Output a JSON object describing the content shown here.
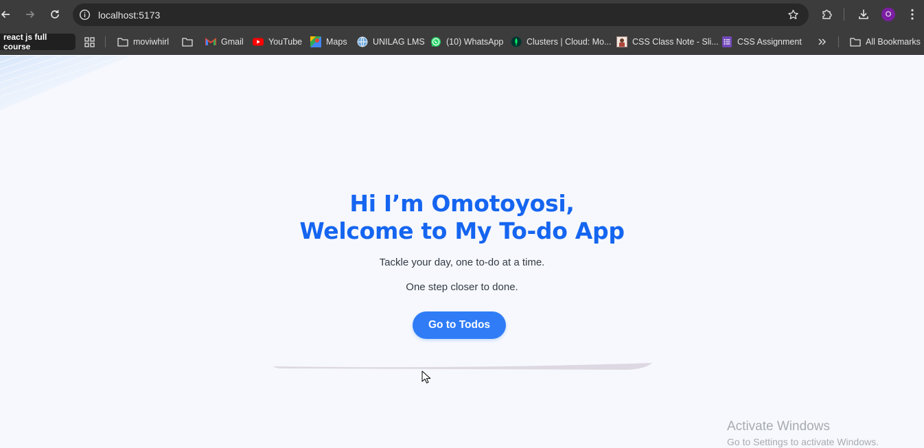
{
  "browser": {
    "url": "localhost:5173",
    "profile_initial": "O",
    "profile_color": "#7b1fa2",
    "icons": {
      "back": "arrow-left-icon",
      "forward": "arrow-right-icon",
      "reload": "reload-icon",
      "site_info": "info-icon",
      "bookmark_star": "star-icon",
      "extensions": "puzzle-icon",
      "downloads": "download-icon",
      "menu": "kebab-menu-icon"
    }
  },
  "bookmarks": {
    "pinned_label": "react js full course",
    "items": [
      {
        "label": "moviwhirl",
        "icon": "folder-icon"
      },
      {
        "label": "",
        "icon": "folder-icon"
      },
      {
        "label": "Gmail",
        "icon": "gmail-icon"
      },
      {
        "label": "YouTube",
        "icon": "youtube-icon"
      },
      {
        "label": "Maps",
        "icon": "maps-icon"
      },
      {
        "label": "UNILAG LMS",
        "icon": "globe-icon"
      },
      {
        "label": "(10) WhatsApp",
        "icon": "whatsapp-icon"
      },
      {
        "label": "Clusters | Cloud: Mo...",
        "icon": "mongodb-leaf-icon"
      },
      {
        "label": "CSS Class Note - Sli...",
        "icon": "slides-icon"
      },
      {
        "label": "CSS Assignment",
        "icon": "forms-icon"
      }
    ],
    "all_bookmarks_label": "All Bookmarks"
  },
  "hero": {
    "title_line1": "Hi I’m Omotoyosi,",
    "title_line2": "Welcome to My To-do App",
    "subtitle1": "Tackle your day, one to-do at a time.",
    "subtitle2": "One step closer to done.",
    "cta_label": "Go to Todos",
    "accent": "#1565f0",
    "button_color": "#2f7cf6"
  },
  "watermark": {
    "title": "Activate Windows",
    "subtitle": "Go to Settings to activate Windows."
  }
}
